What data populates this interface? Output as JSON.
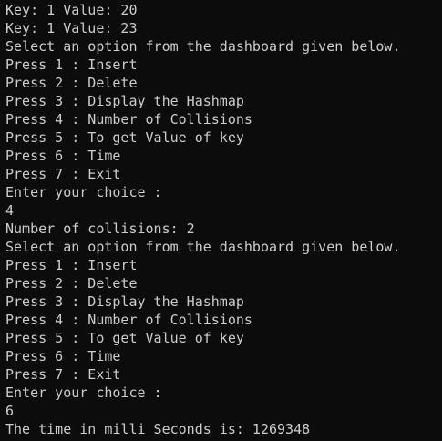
{
  "terminal": {
    "lines": [
      "Key: 1 Value: 20",
      "Key: 1 Value: 23",
      "Select an option from the dashboard given below.",
      "Press 1 : Insert",
      "Press 2 : Delete",
      "Press 3 : Display the Hashmap",
      "Press 4 : Number of Collisions",
      "Press 5 : To get Value of key",
      "Press 6 : Time",
      "Press 7 : Exit",
      "Enter your choice :",
      "4",
      "Number of collisions: 2",
      "Select an option from the dashboard given below.",
      "Press 1 : Insert",
      "Press 2 : Delete",
      "Press 3 : Display the Hashmap",
      "Press 4 : Number of Collisions",
      "Press 5 : To get Value of key",
      "Press 6 : Time",
      "Press 7 : Exit",
      "Enter your choice :",
      "6",
      "The time in milli Seconds is: 1269348"
    ]
  }
}
